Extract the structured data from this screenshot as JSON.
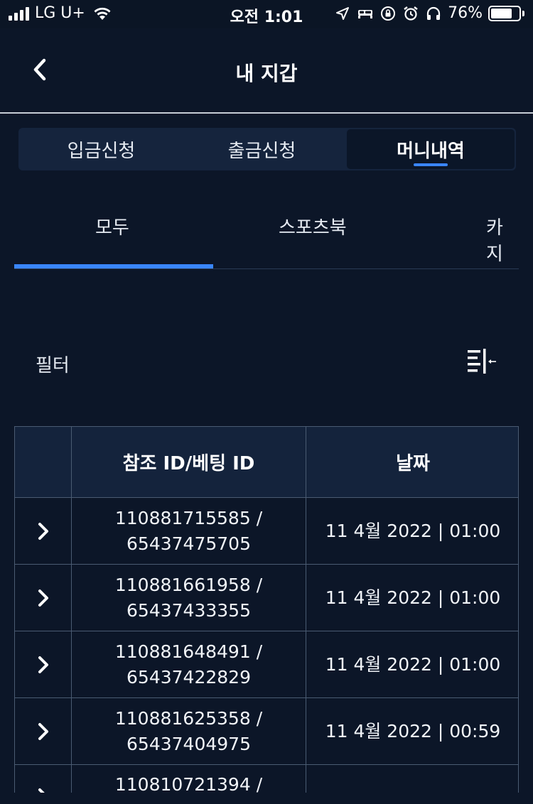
{
  "status_bar": {
    "carrier": "LG U+",
    "time": "오전 1:01",
    "battery_percent": "76%",
    "battery_level": 0.76,
    "icons": [
      "signal-icon",
      "wifi-icon",
      "location-arrow-icon",
      "bed-icon",
      "rotation-lock-icon",
      "alarm-icon",
      "headphones-icon",
      "battery-icon"
    ]
  },
  "header": {
    "title": "내 지갑",
    "back_icon": "chevron-left-icon"
  },
  "segment_tabs": [
    {
      "label": "입금신청",
      "active": false
    },
    {
      "label": "출금신청",
      "active": false
    },
    {
      "label": "머니내역",
      "active": true
    }
  ],
  "sub_tabs": [
    {
      "label": "모두",
      "active": true
    },
    {
      "label": "스포츠북",
      "active": false
    },
    {
      "label": "카지",
      "active": false
    }
  ],
  "filter": {
    "label": "필터",
    "icon": "filter-collapse-icon"
  },
  "table": {
    "columns": [
      "",
      "참조 ID/베팅 ID",
      "날짜"
    ],
    "rows": [
      {
        "ref_id": "110881715585 /",
        "bet_id": "65437475705",
        "date": "11 4월 2022 | 01:00"
      },
      {
        "ref_id": "110881661958 /",
        "bet_id": "65437433355",
        "date": "11 4월 2022 | 01:00"
      },
      {
        "ref_id": "110881648491 /",
        "bet_id": "65437422829",
        "date": "11 4월 2022 | 01:00"
      },
      {
        "ref_id": "110881625358 /",
        "bet_id": "65437404975",
        "date": "11 4월 2022 | 00:59"
      },
      {
        "ref_id": "110810721394 /",
        "bet_id": "",
        "date": ""
      }
    ]
  },
  "colors": {
    "background": "#0c1628",
    "accent": "#3a86ff",
    "segment_bg": "#15243d",
    "table_header_bg": "#14233c",
    "border": "#4a5b72"
  }
}
